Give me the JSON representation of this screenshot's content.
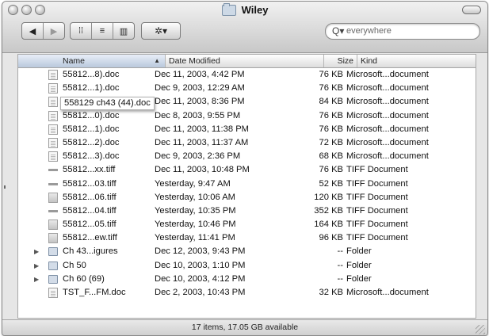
{
  "window": {
    "title": "Wiley",
    "status_text": "17 items, 17.05 GB available"
  },
  "toolbar": {
    "back_glyph": "◀",
    "forward_glyph": "▶",
    "view_icon_glyph": "⁞⁞",
    "view_list_glyph": "≡",
    "view_columns_glyph": "▥",
    "action_glyph": "✲▾",
    "search_glyph": "Q▾",
    "search_placeholder": "everywhere"
  },
  "columns": {
    "name": "Name",
    "date": "Date Modified",
    "size": "Size",
    "kind": "Kind",
    "sort_arrow": "▲"
  },
  "rows": [
    {
      "name": "55812...8).doc",
      "date": "Dec 11, 2003, 4:42 PM",
      "size": "76 KB",
      "kind": "Microsoft...document",
      "icon": "doc"
    },
    {
      "name": "55812...1).doc",
      "date": "Dec 9, 2003, 12:29 AM",
      "size": "76 KB",
      "kind": "Microsoft...document",
      "icon": "doc"
    },
    {
      "name": "55812...4).doc",
      "date": "Dec 11, 2003, 8:36 PM",
      "size": "84 KB",
      "kind": "Microsoft...document",
      "icon": "doc"
    },
    {
      "name": "55812...0).doc",
      "date": "Dec 8, 2003, 9:55 PM",
      "size": "76 KB",
      "kind": "Microsoft...document",
      "icon": "doc"
    },
    {
      "name": "55812...1).doc",
      "date": "Dec 11, 2003, 11:38 PM",
      "size": "76 KB",
      "kind": "Microsoft...document",
      "icon": "doc"
    },
    {
      "name": "55812...2).doc",
      "date": "Dec 11, 2003, 11:37 AM",
      "size": "72 KB",
      "kind": "Microsoft...document",
      "icon": "doc"
    },
    {
      "name": "55812...3).doc",
      "date": "Dec 9, 2003, 2:36 PM",
      "size": "68 KB",
      "kind": "Microsoft...document",
      "icon": "doc"
    },
    {
      "name": "55812...xx.tiff",
      "date": "Dec 11, 2003, 10:48 PM",
      "size": "76 KB",
      "kind": "TIFF Document",
      "icon": "tiffline"
    },
    {
      "name": "55812...03.tiff",
      "date": "Yesterday, 9:47 AM",
      "size": "52 KB",
      "kind": "TIFF Document",
      "icon": "tiffline"
    },
    {
      "name": "55812...06.tiff",
      "date": "Yesterday, 10:06 AM",
      "size": "120 KB",
      "kind": "TIFF Document",
      "icon": "tiff"
    },
    {
      "name": "55812...04.tiff",
      "date": "Yesterday, 10:35 PM",
      "size": "352 KB",
      "kind": "TIFF Document",
      "icon": "tiffline"
    },
    {
      "name": "55812...05.tiff",
      "date": "Yesterday, 10:46 PM",
      "size": "164 KB",
      "kind": "TIFF Document",
      "icon": "tiff"
    },
    {
      "name": "55812...ew.tiff",
      "date": "Yesterday, 11:41 PM",
      "size": "96 KB",
      "kind": "TIFF Document",
      "icon": "tiff"
    },
    {
      "name": "Ch 43...igures",
      "date": "Dec 12, 2003, 9:43 PM",
      "size": "--",
      "kind": "Folder",
      "icon": "folder",
      "disclosure": "▶"
    },
    {
      "name": "Ch 50",
      "date": "Dec 10, 2003, 1:10 PM",
      "size": "--",
      "kind": "Folder",
      "icon": "folder",
      "disclosure": "▶"
    },
    {
      "name": "Ch 60 (69)",
      "date": "Dec 10, 2003, 4:12 PM",
      "size": "--",
      "kind": "Folder",
      "icon": "folder",
      "disclosure": "▶"
    },
    {
      "name": "TST_F...FM.doc",
      "date": "Dec 2, 2003, 10:43 PM",
      "size": "32 KB",
      "kind": "Microsoft...document",
      "icon": "doc"
    }
  ],
  "tooltip": "558129 ch43 (44).doc"
}
